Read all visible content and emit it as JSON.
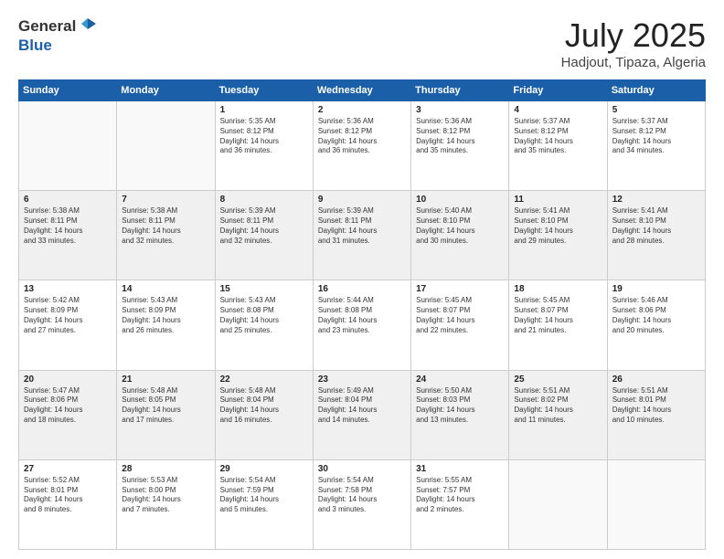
{
  "header": {
    "logo_line1": "General",
    "logo_line2": "Blue",
    "month": "July 2025",
    "location": "Hadjout, Tipaza, Algeria"
  },
  "weekdays": [
    "Sunday",
    "Monday",
    "Tuesday",
    "Wednesday",
    "Thursday",
    "Friday",
    "Saturday"
  ],
  "weeks": [
    [
      {
        "day": "",
        "text": ""
      },
      {
        "day": "",
        "text": ""
      },
      {
        "day": "1",
        "text": "Sunrise: 5:35 AM\nSunset: 8:12 PM\nDaylight: 14 hours\nand 36 minutes."
      },
      {
        "day": "2",
        "text": "Sunrise: 5:36 AM\nSunset: 8:12 PM\nDaylight: 14 hours\nand 36 minutes."
      },
      {
        "day": "3",
        "text": "Sunrise: 5:36 AM\nSunset: 8:12 PM\nDaylight: 14 hours\nand 35 minutes."
      },
      {
        "day": "4",
        "text": "Sunrise: 5:37 AM\nSunset: 8:12 PM\nDaylight: 14 hours\nand 35 minutes."
      },
      {
        "day": "5",
        "text": "Sunrise: 5:37 AM\nSunset: 8:12 PM\nDaylight: 14 hours\nand 34 minutes."
      }
    ],
    [
      {
        "day": "6",
        "text": "Sunrise: 5:38 AM\nSunset: 8:11 PM\nDaylight: 14 hours\nand 33 minutes."
      },
      {
        "day": "7",
        "text": "Sunrise: 5:38 AM\nSunset: 8:11 PM\nDaylight: 14 hours\nand 32 minutes."
      },
      {
        "day": "8",
        "text": "Sunrise: 5:39 AM\nSunset: 8:11 PM\nDaylight: 14 hours\nand 32 minutes."
      },
      {
        "day": "9",
        "text": "Sunrise: 5:39 AM\nSunset: 8:11 PM\nDaylight: 14 hours\nand 31 minutes."
      },
      {
        "day": "10",
        "text": "Sunrise: 5:40 AM\nSunset: 8:10 PM\nDaylight: 14 hours\nand 30 minutes."
      },
      {
        "day": "11",
        "text": "Sunrise: 5:41 AM\nSunset: 8:10 PM\nDaylight: 14 hours\nand 29 minutes."
      },
      {
        "day": "12",
        "text": "Sunrise: 5:41 AM\nSunset: 8:10 PM\nDaylight: 14 hours\nand 28 minutes."
      }
    ],
    [
      {
        "day": "13",
        "text": "Sunrise: 5:42 AM\nSunset: 8:09 PM\nDaylight: 14 hours\nand 27 minutes."
      },
      {
        "day": "14",
        "text": "Sunrise: 5:43 AM\nSunset: 8:09 PM\nDaylight: 14 hours\nand 26 minutes."
      },
      {
        "day": "15",
        "text": "Sunrise: 5:43 AM\nSunset: 8:08 PM\nDaylight: 14 hours\nand 25 minutes."
      },
      {
        "day": "16",
        "text": "Sunrise: 5:44 AM\nSunset: 8:08 PM\nDaylight: 14 hours\nand 23 minutes."
      },
      {
        "day": "17",
        "text": "Sunrise: 5:45 AM\nSunset: 8:07 PM\nDaylight: 14 hours\nand 22 minutes."
      },
      {
        "day": "18",
        "text": "Sunrise: 5:45 AM\nSunset: 8:07 PM\nDaylight: 14 hours\nand 21 minutes."
      },
      {
        "day": "19",
        "text": "Sunrise: 5:46 AM\nSunset: 8:06 PM\nDaylight: 14 hours\nand 20 minutes."
      }
    ],
    [
      {
        "day": "20",
        "text": "Sunrise: 5:47 AM\nSunset: 8:06 PM\nDaylight: 14 hours\nand 18 minutes."
      },
      {
        "day": "21",
        "text": "Sunrise: 5:48 AM\nSunset: 8:05 PM\nDaylight: 14 hours\nand 17 minutes."
      },
      {
        "day": "22",
        "text": "Sunrise: 5:48 AM\nSunset: 8:04 PM\nDaylight: 14 hours\nand 16 minutes."
      },
      {
        "day": "23",
        "text": "Sunrise: 5:49 AM\nSunset: 8:04 PM\nDaylight: 14 hours\nand 14 minutes."
      },
      {
        "day": "24",
        "text": "Sunrise: 5:50 AM\nSunset: 8:03 PM\nDaylight: 14 hours\nand 13 minutes."
      },
      {
        "day": "25",
        "text": "Sunrise: 5:51 AM\nSunset: 8:02 PM\nDaylight: 14 hours\nand 11 minutes."
      },
      {
        "day": "26",
        "text": "Sunrise: 5:51 AM\nSunset: 8:01 PM\nDaylight: 14 hours\nand 10 minutes."
      }
    ],
    [
      {
        "day": "27",
        "text": "Sunrise: 5:52 AM\nSunset: 8:01 PM\nDaylight: 14 hours\nand 8 minutes."
      },
      {
        "day": "28",
        "text": "Sunrise: 5:53 AM\nSunset: 8:00 PM\nDaylight: 14 hours\nand 7 minutes."
      },
      {
        "day": "29",
        "text": "Sunrise: 5:54 AM\nSunset: 7:59 PM\nDaylight: 14 hours\nand 5 minutes."
      },
      {
        "day": "30",
        "text": "Sunrise: 5:54 AM\nSunset: 7:58 PM\nDaylight: 14 hours\nand 3 minutes."
      },
      {
        "day": "31",
        "text": "Sunrise: 5:55 AM\nSunset: 7:57 PM\nDaylight: 14 hours\nand 2 minutes."
      },
      {
        "day": "",
        "text": ""
      },
      {
        "day": "",
        "text": ""
      }
    ]
  ]
}
